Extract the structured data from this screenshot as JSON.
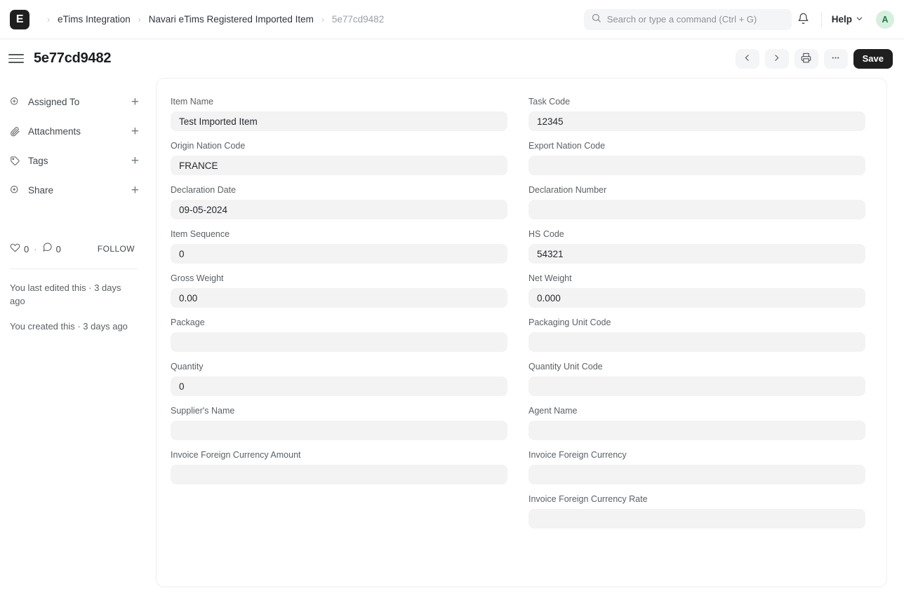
{
  "navbar": {
    "logo_letter": "E",
    "breadcrumbs": [
      {
        "label": "eTims Integration",
        "muted": false
      },
      {
        "label": "Navari eTims Registered Imported Item",
        "muted": false
      },
      {
        "label": "5e77cd9482",
        "muted": true
      }
    ],
    "separator": "›",
    "search": {
      "placeholder": "Search or type a command (Ctrl + G)",
      "value": ""
    },
    "notifications_icon": "bell-icon",
    "help_label": "Help",
    "avatar_letter": "A",
    "avatar_bg": "#d7efdf",
    "avatar_fg": "#1f7a45"
  },
  "toolbar": {
    "menu_icon": "hamburger-icon",
    "title": "5e77cd9482",
    "prev_label": "‹",
    "next_label": "›",
    "print_icon": "printer-icon",
    "more_label": "···",
    "save_label": "Save",
    "save_bg": "#1f1f1f"
  },
  "sidebar": {
    "items": [
      {
        "icon": "assign-user-icon",
        "label": "Assigned To",
        "add": "+"
      },
      {
        "icon": "paperclip-icon",
        "label": "Attachments",
        "add": "+"
      },
      {
        "icon": "tag-icon",
        "label": "Tags",
        "add": "+"
      },
      {
        "icon": "share-user-icon",
        "label": "Share",
        "add": "+"
      }
    ],
    "social": {
      "like_icon": "heart-icon",
      "like_count": "0",
      "dot": "·",
      "comment_icon": "comment-icon",
      "comment_count": "0",
      "follow_label": "FOLLOW"
    },
    "meta": [
      "You last edited this · 3 days ago",
      "You created this · 3 days ago"
    ]
  },
  "form": {
    "left": [
      {
        "label": "Item Name",
        "value": "Test Imported Item"
      },
      {
        "label": "Origin Nation Code",
        "value": "FRANCE"
      },
      {
        "label": "Declaration Date",
        "value": "09-05-2024"
      },
      {
        "label": "Item Sequence",
        "value": "0"
      },
      {
        "label": "Gross Weight",
        "value": "0.00"
      },
      {
        "label": "Package",
        "value": ""
      },
      {
        "label": "Quantity",
        "value": "0"
      },
      {
        "label": "Supplier's Name",
        "value": ""
      },
      {
        "label": "Invoice Foreign Currency Amount",
        "value": ""
      }
    ],
    "right": [
      {
        "label": "Task Code",
        "value": "12345"
      },
      {
        "label": "Export Nation Code",
        "value": ""
      },
      {
        "label": "Declaration Number",
        "value": ""
      },
      {
        "label": "HS Code",
        "value": "54321"
      },
      {
        "label": "Net Weight",
        "value": "0.000"
      },
      {
        "label": "Packaging Unit Code",
        "value": ""
      },
      {
        "label": "Quantity Unit Code",
        "value": ""
      },
      {
        "label": "Agent Name",
        "value": ""
      },
      {
        "label": "Invoice Foreign Currency",
        "value": ""
      },
      {
        "label": "Invoice Foreign Currency Rate",
        "value": ""
      }
    ]
  }
}
